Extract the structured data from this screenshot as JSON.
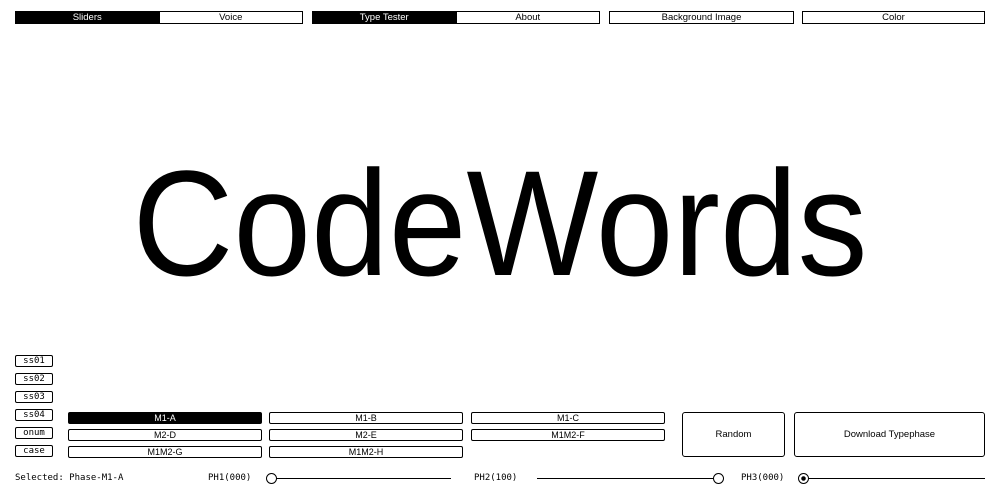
{
  "tabs_group1": {
    "sliders": "Sliders",
    "voice": "Voice"
  },
  "tabs_group2": {
    "type_tester": "Type Tester",
    "about": "About"
  },
  "background_image": "Background Image",
  "color": "Color",
  "specimen_text": "CodeWords",
  "features": [
    "ss01",
    "ss02",
    "ss03",
    "ss04",
    "onum",
    "case"
  ],
  "phases": {
    "m1a": "M1-A",
    "m1b": "M1-B",
    "m1c": "M1-C",
    "m2d": "M2-D",
    "m2e": "M2-E",
    "m1m2f": "M1M2-F",
    "m1m2g": "M1M2-G",
    "m1m2h": "M1M2-H"
  },
  "random": "Random",
  "download": "Download Typephase",
  "selected": "Selected: Phase-M1-A",
  "sliders": {
    "ph1": {
      "label": "PH1(000)",
      "value": 0
    },
    "ph2": {
      "label": "PH2(100)",
      "value": 100
    },
    "ph3": {
      "label": "PH3(000)",
      "value": 0
    }
  }
}
